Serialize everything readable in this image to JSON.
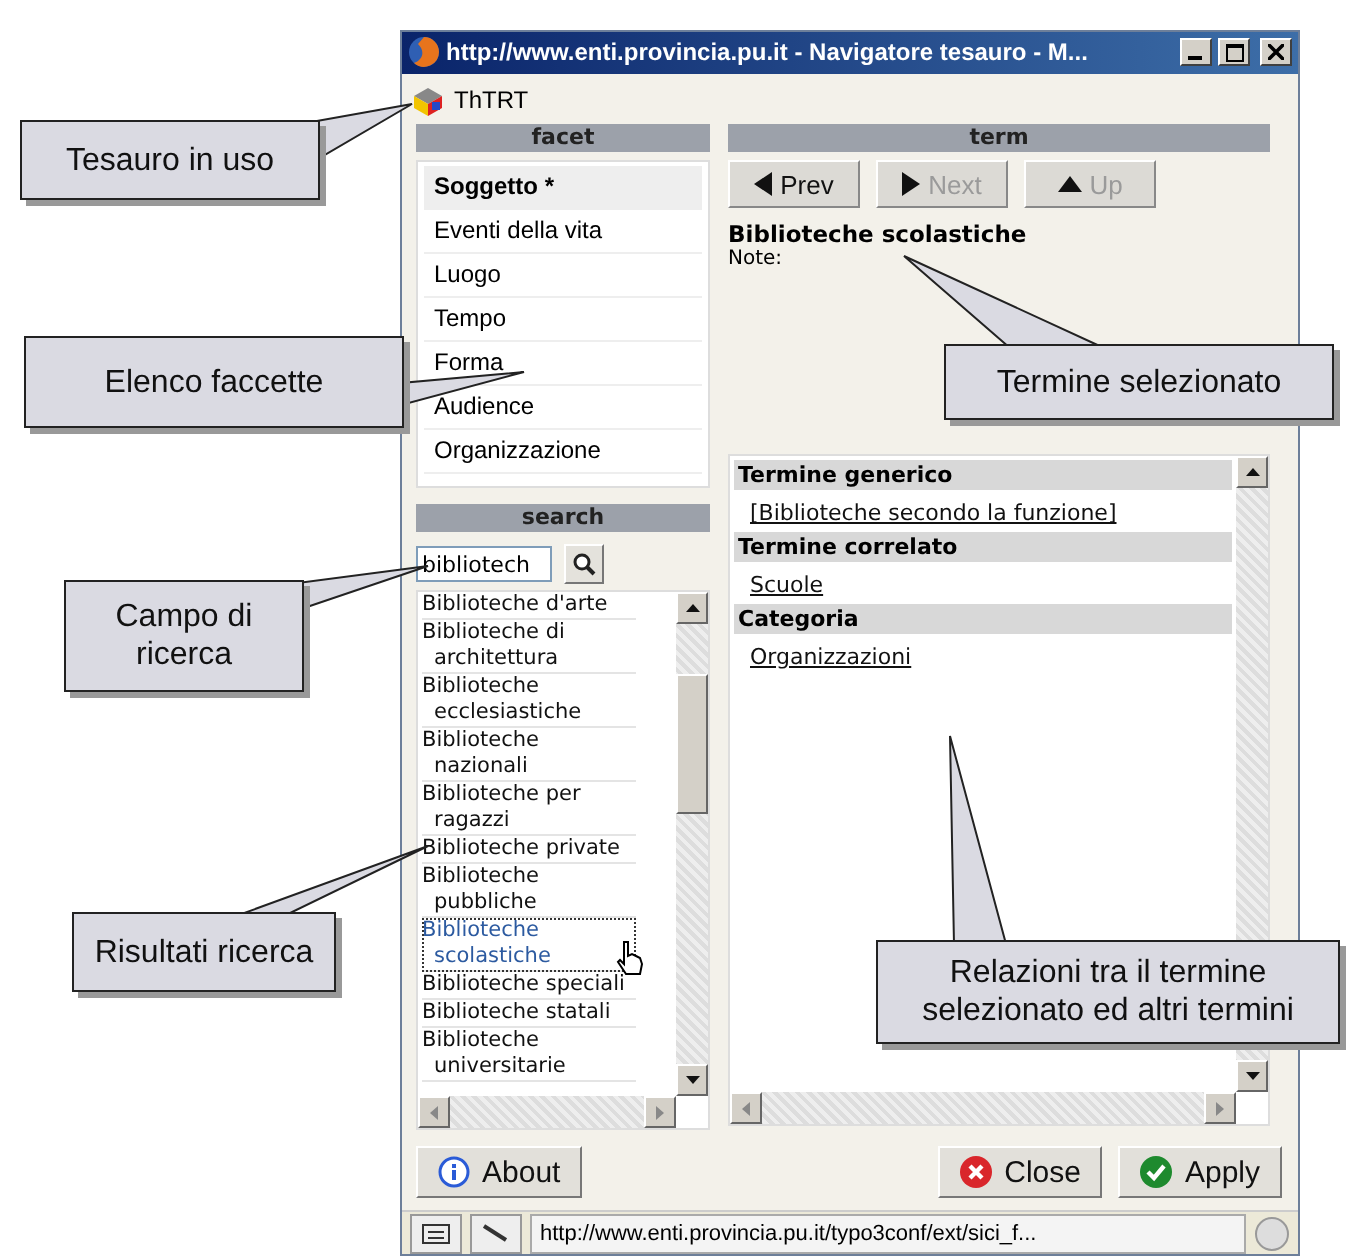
{
  "window": {
    "title": "http://www.enti.provincia.pu.it - Navigatore tesauro - M..."
  },
  "thesaurus": {
    "label": "ThTRT"
  },
  "facet": {
    "header": "facet",
    "items": [
      {
        "label": "Soggetto *",
        "selected": true
      },
      {
        "label": "Eventi della vita",
        "selected": false
      },
      {
        "label": "Luogo",
        "selected": false
      },
      {
        "label": "Tempo",
        "selected": false
      },
      {
        "label": "Forma",
        "selected": false
      },
      {
        "label": "Audience",
        "selected": false
      },
      {
        "label": "Organizzazione",
        "selected": false
      }
    ]
  },
  "search": {
    "header": "search",
    "value": "bibliotech",
    "results": [
      {
        "label": "Biblioteche d'arte",
        "selected": false
      },
      {
        "label": "Biblioteche di architettura",
        "selected": false
      },
      {
        "label": "Biblioteche ecclesiastiche",
        "selected": false
      },
      {
        "label": "Biblioteche nazionali",
        "selected": false
      },
      {
        "label": "Biblioteche per ragazzi",
        "selected": false
      },
      {
        "label": "Biblioteche private",
        "selected": false
      },
      {
        "label": "Biblioteche pubbliche",
        "selected": false
      },
      {
        "label": "Biblioteche scolastiche",
        "selected": true
      },
      {
        "label": "Biblioteche speciali",
        "selected": false
      },
      {
        "label": "Biblioteche statali",
        "selected": false
      },
      {
        "label": "Biblioteche universitarie",
        "selected": false
      }
    ]
  },
  "term": {
    "header": "term",
    "nav": [
      {
        "label": "Prev",
        "kind": "prev",
        "disabled": false
      },
      {
        "label": "Next",
        "kind": "next",
        "disabled": true
      },
      {
        "label": "Up",
        "kind": "up",
        "disabled": true
      }
    ],
    "title": "Biblioteche scolastiche",
    "note": "Note:",
    "relations": [
      {
        "header": "Termine generico",
        "links": [
          "[Biblioteche secondo la funzione]"
        ]
      },
      {
        "header": "Termine correlato",
        "links": [
          "Scuole"
        ]
      },
      {
        "header": "Categoria",
        "links": [
          "Organizzazioni"
        ]
      }
    ]
  },
  "buttons": [
    {
      "label": "About",
      "kind": "about"
    },
    {
      "label": "Close",
      "kind": "close"
    },
    {
      "label": "Apply",
      "kind": "apply"
    }
  ],
  "status_bar": {
    "url": "http://www.enti.provincia.pu.it/typo3conf/ext/sici_f..."
  },
  "callouts": [
    {
      "text": "Tesauro in uso"
    },
    {
      "text": "Elenco faccette"
    },
    {
      "text": "Campo di ricerca"
    },
    {
      "text": "Risultati ricerca"
    },
    {
      "text": "Termine selezionato"
    },
    {
      "text": "Relazioni tra il termine selezionato ed altri termini"
    }
  ]
}
